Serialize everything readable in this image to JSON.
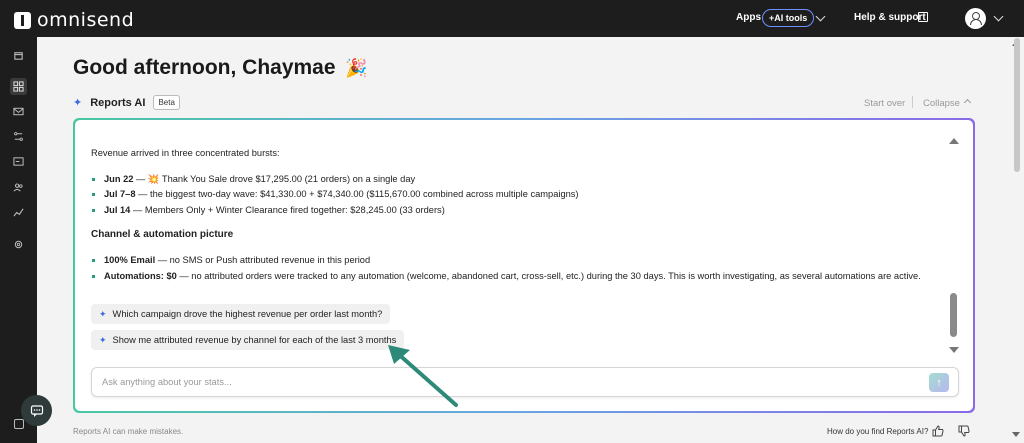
{
  "app": {
    "brand": "omnisend"
  },
  "topbar": {
    "apps_label": "Apps",
    "ai_tools_label": "+AI tools",
    "help_label": "Help & support"
  },
  "sidebar": {
    "items": [
      {
        "icon": "store-icon"
      },
      {
        "icon": "dashboard-icon",
        "active": true
      },
      {
        "icon": "mail-icon"
      },
      {
        "icon": "automation-icon"
      },
      {
        "icon": "forms-icon"
      },
      {
        "icon": "audience-icon"
      },
      {
        "icon": "reports-icon"
      },
      {
        "icon": "settings-icon"
      }
    ]
  },
  "main": {
    "greeting": "Good afternoon, Chaymae",
    "greeting_emoji": "🎉",
    "reports": {
      "title": "Reports AI",
      "badge": "Beta",
      "start_over": "Start over",
      "collapse": "Collapse"
    },
    "chat": {
      "intro": "Revenue arrived in three concentrated bursts:",
      "bursts": [
        {
          "bold": "Jun 22",
          "text": " — 💥 Thank You Sale drove $17,295.00 (21 orders) on a single day"
        },
        {
          "bold": "Jul 7–8",
          "text": " — the biggest two-day wave: $41,330.00 + $74,340.00 ($115,670.00 combined across multiple campaigns)"
        },
        {
          "bold": "Jul 14",
          "text": " — Members Only + Winter Clearance fired together: $28,245.00 (33 orders)"
        }
      ],
      "section_heading": "Channel & automation picture",
      "channel_items": [
        {
          "bold": "100% Email",
          "text": " — no SMS or Push attributed revenue in this period"
        },
        {
          "bold": "Automations: $0",
          "text": " — no attributed orders were tracked to any automation (welcome, abandoned cart, cross-sell, etc.) during the 30 days. This is worth investigating, as several automations are active."
        }
      ]
    },
    "suggestions": [
      "Which campaign drove the highest revenue per order last month?",
      "Show me attributed revenue by channel for each of the last 3 months"
    ],
    "ask_input": {
      "placeholder": "Ask anything about your stats...",
      "value": ""
    },
    "footer": {
      "disclaimer": "Reports AI can make mistakes.",
      "feedback_question": "How do you find Reports AI?"
    }
  },
  "colors": {
    "topbar_bg": "#1d1d1d",
    "accent_teal": "#2c9a80",
    "accent_blue": "#3d6be0",
    "annotation_arrow": "#2e8a78"
  }
}
